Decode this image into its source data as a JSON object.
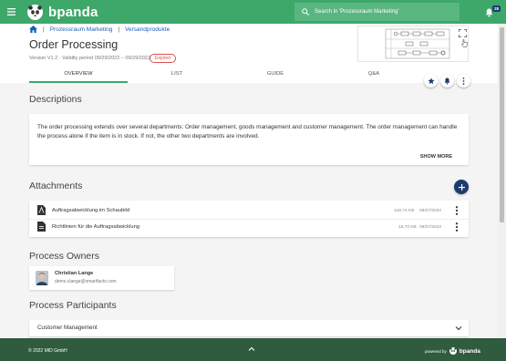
{
  "topbar": {
    "brand": "bpanda",
    "search_placeholder": "Search in 'Prozessraum Marketing'",
    "notification_count": "28"
  },
  "breadcrumb": {
    "items": [
      "Prozessraum Marketing",
      "Versandprodukte"
    ]
  },
  "header": {
    "title": "Order Processing",
    "version": "Version V1.2 · Validity period 09/29/2022 – 09/29/2022",
    "status_badge": "Expired"
  },
  "tabs": [
    {
      "label": "OVERVIEW",
      "active": true
    },
    {
      "label": "LIST",
      "active": false
    },
    {
      "label": "GUIDE",
      "active": false
    },
    {
      "label": "Q&A",
      "active": false
    }
  ],
  "descriptions": {
    "title": "Descriptions",
    "text": "The order processing extends over several departments: Order management, goods management and customer management. The order management can handle the process alone if the item is in stock. If not, the other two departments are involved.",
    "show_more": "SHOW MORE"
  },
  "attachments": {
    "title": "Attachments",
    "items": [
      {
        "name": "Auftragsabwicklung im Schaubild",
        "size": "128.74 KB",
        "date": "09/27/2022"
      },
      {
        "name": "Richtlinien für die Auftragsabwicklung",
        "size": "16.70 KB",
        "date": "09/27/2022"
      }
    ]
  },
  "process_owners": {
    "title": "Process Owners",
    "owner": {
      "name": "Christian Lange",
      "email": "demo.clange@smartfacts.com"
    }
  },
  "process_participants": {
    "title": "Process Participants",
    "items": [
      "Customer Management"
    ]
  },
  "footer": {
    "copyright": "© 2022 MID GmbH",
    "powered_by": "powered by",
    "brand": "bpanda"
  },
  "colors": {
    "primary_green": "#3ea76a",
    "footer_green": "#2f5b3f",
    "navy": "#1e3b6e",
    "expired_red": "#d9534f"
  }
}
